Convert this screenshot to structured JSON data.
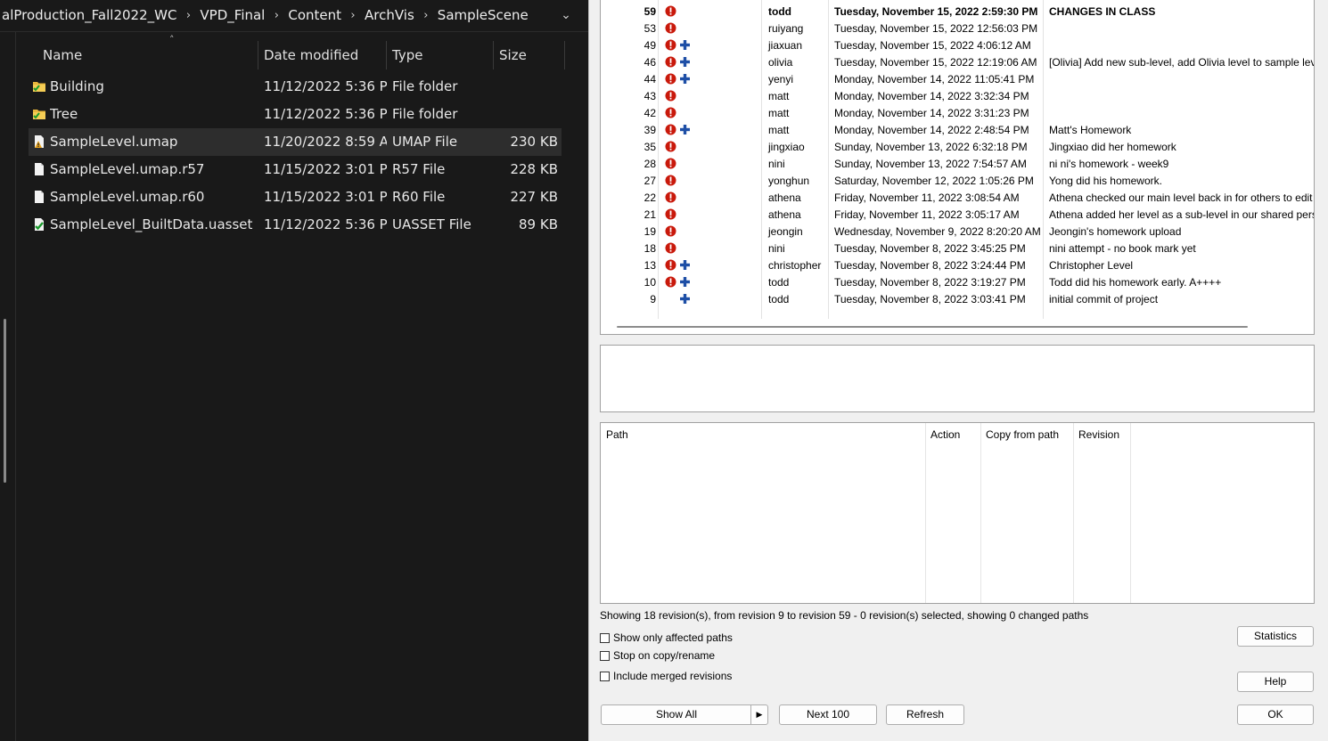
{
  "explorer": {
    "breadcrumb": [
      "alProduction_Fall2022_WC",
      "VPD_Final",
      "Content",
      "ArchVis",
      "SampleScene"
    ],
    "columns": {
      "name": "Name",
      "date": "Date modified",
      "type": "Type",
      "size": "Size"
    },
    "files": [
      {
        "name": "Building",
        "date": "11/12/2022 5:36 P...",
        "type": "File folder",
        "size": "",
        "icon": "folder-icon"
      },
      {
        "name": "Tree",
        "date": "11/12/2022 5:36 P...",
        "type": "File folder",
        "size": "",
        "icon": "folder-icon"
      },
      {
        "name": "SampleLevel.umap",
        "date": "11/20/2022 8:59 A...",
        "type": "UMAP File",
        "size": "230 KB",
        "icon": "modified-file-icon"
      },
      {
        "name": "SampleLevel.umap.r57",
        "date": "11/15/2022 3:01 P...",
        "type": "R57 File",
        "size": "228 KB",
        "icon": "file-icon"
      },
      {
        "name": "SampleLevel.umap.r60",
        "date": "11/15/2022 3:01 P...",
        "type": "R60 File",
        "size": "227 KB",
        "icon": "file-icon"
      },
      {
        "name": "SampleLevel_BuiltData.uasset",
        "date": "11/12/2022 5:36 P...",
        "type": "UASSET File",
        "size": "89 KB",
        "icon": "versioned-file-icon"
      }
    ]
  },
  "svnlog": {
    "revisions": [
      {
        "rev": "59",
        "plus": false,
        "author": "todd",
        "date": "Tuesday, November 15, 2022 2:59:30 PM",
        "message": "CHANGES IN CLASS"
      },
      {
        "rev": "53",
        "plus": false,
        "author": "ruiyang",
        "date": "Tuesday, November 15, 2022 12:56:03 PM",
        "message": ""
      },
      {
        "rev": "49",
        "plus": true,
        "author": "jiaxuan",
        "date": "Tuesday, November 15, 2022 4:06:12 AM",
        "message": ""
      },
      {
        "rev": "46",
        "plus": true,
        "author": "olivia",
        "date": "Tuesday, November 15, 2022 12:19:06 AM",
        "message": "[Olivia] Add new sub-level, add Olivia level to sample lev"
      },
      {
        "rev": "44",
        "plus": true,
        "author": "yenyi",
        "date": "Monday, November 14, 2022 11:05:41 PM",
        "message": ""
      },
      {
        "rev": "43",
        "plus": false,
        "author": "matt",
        "date": "Monday, November 14, 2022 3:32:34 PM",
        "message": ""
      },
      {
        "rev": "42",
        "plus": false,
        "author": "matt",
        "date": "Monday, November 14, 2022 3:31:23 PM",
        "message": ""
      },
      {
        "rev": "39",
        "plus": true,
        "author": "matt",
        "date": "Monday, November 14, 2022 2:48:54 PM",
        "message": "Matt's Homework"
      },
      {
        "rev": "35",
        "plus": false,
        "author": "jingxiao",
        "date": "Sunday, November 13, 2022 6:32:18 PM",
        "message": "Jingxiao did her homework"
      },
      {
        "rev": "28",
        "plus": false,
        "author": "nini",
        "date": "Sunday, November 13, 2022 7:54:57 AM",
        "message": "ni ni's homework - week9"
      },
      {
        "rev": "27",
        "plus": false,
        "author": "yonghun",
        "date": "Saturday, November 12, 2022 1:05:26 PM",
        "message": "Yong did his homework."
      },
      {
        "rev": "22",
        "plus": false,
        "author": "athena",
        "date": "Friday, November 11, 2022 3:08:54 AM",
        "message": "Athena checked our main level back in for others to edit"
      },
      {
        "rev": "21",
        "plus": false,
        "author": "athena",
        "date": "Friday, November 11, 2022 3:05:17 AM",
        "message": "Athena added her level as a sub-level in our shared persi"
      },
      {
        "rev": "19",
        "plus": false,
        "author": "jeongin",
        "date": "Wednesday, November 9, 2022 8:20:20 AM",
        "message": "Jeongin's homework upload"
      },
      {
        "rev": "18",
        "plus": false,
        "author": "nini",
        "date": "Tuesday, November 8, 2022 3:45:25 PM",
        "message": "nini attempt - no book mark yet"
      },
      {
        "rev": "13",
        "plus": true,
        "author": "christopher",
        "date": "Tuesday, November 8, 2022 3:24:44 PM",
        "message": "Christopher Level"
      },
      {
        "rev": "10",
        "plus": true,
        "author": "todd",
        "date": "Tuesday, November 8, 2022 3:19:27 PM",
        "message": "Todd did his homework early.  A++++"
      },
      {
        "rev": "9",
        "plus": true,
        "noexcl": true,
        "author": "todd",
        "date": "Tuesday, November 8, 2022 3:03:41 PM",
        "message": "initial commit of project"
      }
    ],
    "paths_columns": {
      "path": "Path",
      "action": "Action",
      "copy_from": "Copy from path",
      "revision": "Revision"
    },
    "status": "Showing 18 revision(s), from revision 9 to revision 59 - 0 revision(s) selected, showing 0 changed paths",
    "checkboxes": {
      "affected": "Show only affected paths",
      "stop_copy": "Stop on copy/rename",
      "merged": "Include merged revisions"
    },
    "buttons": {
      "show_all": "Show All",
      "next100": "Next 100",
      "refresh": "Refresh",
      "statistics": "Statistics",
      "help": "Help",
      "ok": "OK"
    },
    "colors": {
      "excl": "#c9190b",
      "plus": "#1e4fa6"
    }
  }
}
